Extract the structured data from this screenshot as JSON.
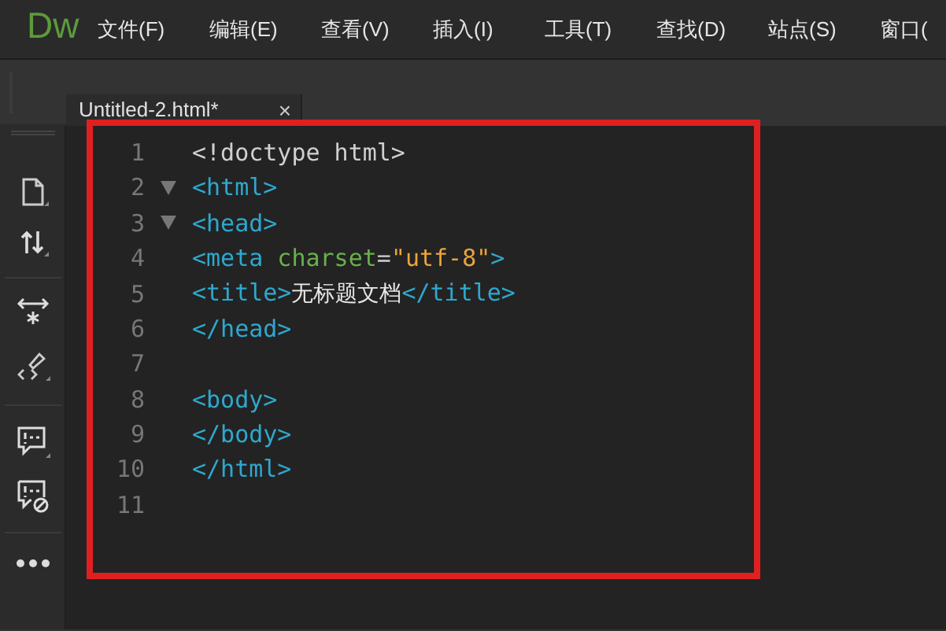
{
  "app_logo": "Dw",
  "menu": [
    "文件(F)",
    "编辑(E)",
    "查看(V)",
    "插入(I)",
    "工具(T)",
    "查找(D)",
    "站点(S)",
    "窗口("
  ],
  "tabs": [
    {
      "label": "Untitled-2.html*",
      "selected": true,
      "close": "×"
    }
  ],
  "editor": {
    "lines": [
      {
        "number": "1",
        "foldable": false,
        "tokens": [
          {
            "kind": "doctype",
            "text": "<!doctype html>"
          }
        ]
      },
      {
        "number": "2",
        "foldable": true,
        "tokens": [
          {
            "kind": "tag",
            "text": "<html>"
          }
        ]
      },
      {
        "number": "3",
        "foldable": true,
        "tokens": [
          {
            "kind": "tag",
            "text": "<head>"
          }
        ]
      },
      {
        "number": "4",
        "foldable": false,
        "tokens": [
          {
            "kind": "tag",
            "text": "<meta"
          },
          {
            "kind": "attr",
            "text": " charset"
          },
          {
            "kind": "plain",
            "text": "="
          },
          {
            "kind": "string",
            "text": "\"utf-8\""
          },
          {
            "kind": "tag",
            "text": ">"
          }
        ]
      },
      {
        "number": "5",
        "foldable": false,
        "tokens": [
          {
            "kind": "tag",
            "text": "<title>"
          },
          {
            "kind": "text",
            "text": "无标题文档"
          },
          {
            "kind": "tag",
            "text": "</title>"
          }
        ]
      },
      {
        "number": "6",
        "foldable": false,
        "tokens": [
          {
            "kind": "tag",
            "text": "</head>"
          }
        ]
      },
      {
        "number": "7",
        "foldable": false
      },
      {
        "number": "8",
        "foldable": false,
        "tokens": [
          {
            "kind": "tag",
            "text": "<body>"
          }
        ]
      },
      {
        "number": "9",
        "foldable": false,
        "tokens": [
          {
            "kind": "tag",
            "text": "</body>"
          }
        ]
      },
      {
        "number": "10",
        "foldable": false,
        "tokens": [
          {
            "kind": "tag",
            "text": "</html>"
          }
        ]
      },
      {
        "number": "11",
        "foldable": false
      }
    ]
  }
}
